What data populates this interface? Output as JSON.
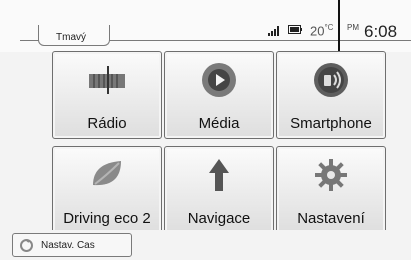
{
  "status": {
    "mode_label": "Tmavý",
    "temperature": "20",
    "temperature_unit": "°C",
    "ampm": "PM",
    "time": "6:08"
  },
  "tiles": [
    {
      "label": "Rádio",
      "icon": "radio-icon"
    },
    {
      "label": "Média",
      "icon": "media-play-icon"
    },
    {
      "label": "Smartphone",
      "icon": "smartphone-icon"
    },
    {
      "label": "Driving eco 2",
      "icon": "eco-leaf-icon"
    },
    {
      "label": "Navigace",
      "icon": "navigation-arrow-icon"
    },
    {
      "label": "Nastavení",
      "icon": "gear-icon"
    }
  ],
  "bottom": {
    "button_label": "Nastav. Cas",
    "button_icon": "clock-settings-icon"
  }
}
